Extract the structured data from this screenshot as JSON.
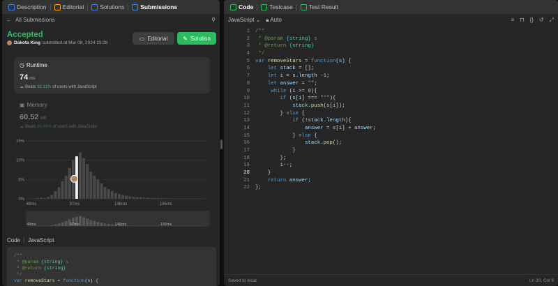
{
  "left_tabs": [
    {
      "label": "Description",
      "icon": "description-icon",
      "color": "#3b82f6"
    },
    {
      "label": "Editorial",
      "icon": "editorial-icon",
      "color": "#ffa116"
    },
    {
      "label": "Solutions",
      "icon": "flask-icon",
      "color": "#3b82f6"
    },
    {
      "label": "Submissions",
      "icon": "history-icon",
      "color": "#3b82f6"
    }
  ],
  "nav": {
    "back_label": "All Submissions"
  },
  "result": {
    "status": "Accepted",
    "author": "Dakota King",
    "submitted_text": "submitted at Mar 08, 2024 15:28",
    "editorial_btn": "Editorial",
    "solution_btn": "Solution"
  },
  "runtime": {
    "title": "Runtime",
    "value": "74",
    "unit": "ms",
    "beats_label": "Beats",
    "beats_pct": "92.11%",
    "beats_suffix": "of users with JavaScript"
  },
  "memory": {
    "title": "Memory",
    "value": "60.52",
    "unit": "MB",
    "beats_label": "Beats",
    "beats_pct": "80.48%",
    "beats_suffix": "of users with JavaScript"
  },
  "chart_data": {
    "type": "bar",
    "yticks": [
      "15%",
      "10%",
      "5%",
      "0%"
    ],
    "xticks": [
      "48ms",
      "97ms",
      "146ms",
      "195ms"
    ],
    "values": [
      0.1,
      0.2,
      0.3,
      0.2,
      0.5,
      1,
      2,
      3,
      4.5,
      6,
      8,
      10,
      11,
      12,
      10.5,
      9,
      7,
      6,
      5,
      4,
      3,
      2.5,
      2,
      1.5,
      1.2,
      1,
      0.8,
      0.6,
      0.5,
      0.4,
      0.4,
      0.3,
      0.3,
      0.2,
      0.2,
      0.2,
      0.15,
      0.1,
      0.1,
      0.1,
      0.1,
      0.1,
      0.05,
      0.05,
      0.05,
      0.05,
      0.05,
      0.05
    ],
    "highlight_index": 12,
    "ylim": [
      0,
      15
    ],
    "color": "#4a4a4a",
    "highlight_color": "#eff1f6"
  },
  "code_section": {
    "label": "Code",
    "language": "JavaScript"
  },
  "right_tabs": [
    {
      "label": "Code",
      "icon": "code-icon",
      "color": "#2cbb5d"
    },
    {
      "label": "Testcase",
      "icon": "checkbox-icon",
      "color": "#2cbb5d"
    },
    {
      "label": "Test Result",
      "icon": "terminal-icon",
      "color": "#2cbb5d"
    }
  ],
  "editor": {
    "language": "JavaScript",
    "mode": "Auto",
    "status_left": "Saved to local",
    "status_right": "Ln 20, Col 9",
    "current_line": 20,
    "lines": [
      [
        [
          "cm",
          "/**"
        ]
      ],
      [
        [
          "cm",
          " * @param "
        ],
        [
          "ty",
          "{string}"
        ],
        [
          "cm",
          " s"
        ]
      ],
      [
        [
          "cm",
          " * @return "
        ],
        [
          "ty",
          "{string}"
        ]
      ],
      [
        [
          "cm",
          " */"
        ]
      ],
      [
        [
          "kw",
          "var "
        ],
        [
          "fn",
          "removeStars"
        ],
        [
          "tx",
          " = "
        ],
        [
          "kw",
          "function"
        ],
        [
          "tx",
          "("
        ],
        [
          "pr",
          "s"
        ],
        [
          "tx",
          ") {"
        ]
      ],
      [
        [
          "tx",
          "    "
        ],
        [
          "kw",
          "let "
        ],
        [
          "pr",
          "stack"
        ],
        [
          "tx",
          " = [];"
        ]
      ],
      [
        [
          "tx",
          "    "
        ],
        [
          "kw",
          "let "
        ],
        [
          "pr",
          "i"
        ],
        [
          "tx",
          " = "
        ],
        [
          "pr",
          "s"
        ],
        [
          "tx",
          "."
        ],
        [
          "pr",
          "length"
        ],
        [
          "tx",
          " -"
        ],
        [
          "num",
          "1"
        ],
        [
          "tx",
          ";"
        ]
      ],
      [
        [
          "tx",
          "    "
        ],
        [
          "kw",
          "let "
        ],
        [
          "pr",
          "answer"
        ],
        [
          "tx",
          " = "
        ],
        [
          "str",
          "\"\""
        ],
        [
          "tx",
          ";"
        ]
      ],
      [
        [
          "tx",
          "     "
        ],
        [
          "kw",
          "while"
        ],
        [
          "tx",
          " ("
        ],
        [
          "pr",
          "i"
        ],
        [
          "tx",
          " >= "
        ],
        [
          "num",
          "0"
        ],
        [
          "tx",
          "){"
        ]
      ],
      [
        [
          "tx",
          "        "
        ],
        [
          "kw",
          "if"
        ],
        [
          "tx",
          " ("
        ],
        [
          "pr",
          "s"
        ],
        [
          "tx",
          "["
        ],
        [
          "pr",
          "i"
        ],
        [
          "tx",
          "] === "
        ],
        [
          "str",
          "\"*\""
        ],
        [
          "tx",
          "){"
        ]
      ],
      [
        [
          "tx",
          "            "
        ],
        [
          "pr",
          "stack"
        ],
        [
          "tx",
          "."
        ],
        [
          "fn",
          "push"
        ],
        [
          "tx",
          "("
        ],
        [
          "pr",
          "s"
        ],
        [
          "tx",
          "["
        ],
        [
          "pr",
          "i"
        ],
        [
          "tx",
          "]);"
        ]
      ],
      [
        [
          "tx",
          "        } "
        ],
        [
          "kw",
          "else"
        ],
        [
          "tx",
          " {"
        ]
      ],
      [
        [
          "tx",
          "            "
        ],
        [
          "kw",
          "if"
        ],
        [
          "tx",
          " (!"
        ],
        [
          "pr",
          "stack"
        ],
        [
          "tx",
          "."
        ],
        [
          "pr",
          "length"
        ],
        [
          "tx",
          "){"
        ]
      ],
      [
        [
          "tx",
          "                "
        ],
        [
          "pr",
          "answer"
        ],
        [
          "tx",
          " = "
        ],
        [
          "pr",
          "s"
        ],
        [
          "tx",
          "["
        ],
        [
          "pr",
          "i"
        ],
        [
          "tx",
          "] + "
        ],
        [
          "pr",
          "answer"
        ],
        [
          "tx",
          ";"
        ]
      ],
      [
        [
          "tx",
          "            } "
        ],
        [
          "kw",
          "else"
        ],
        [
          "tx",
          " {"
        ]
      ],
      [
        [
          "tx",
          "                "
        ],
        [
          "pr",
          "stack"
        ],
        [
          "tx",
          "."
        ],
        [
          "fn",
          "pop"
        ],
        [
          "tx",
          "();"
        ]
      ],
      [
        [
          "tx",
          "            }"
        ]
      ],
      [
        [
          "tx",
          "        };"
        ]
      ],
      [
        [
          "tx",
          "        "
        ],
        [
          "pr",
          "i"
        ],
        [
          "tx",
          "--;"
        ]
      ],
      [
        [
          "tx",
          "    }"
        ]
      ],
      [
        [
          "tx",
          "    "
        ],
        [
          "kw",
          "return "
        ],
        [
          "pr",
          "answer"
        ],
        [
          "tx",
          ";"
        ]
      ],
      [
        [
          "tx",
          "};"
        ]
      ]
    ]
  },
  "preview_lines": [
    [
      [
        "cm",
        "/**"
      ]
    ],
    [
      [
        "cm",
        " * @param "
      ],
      [
        "ty",
        "{string}"
      ],
      [
        "cm",
        " s"
      ]
    ],
    [
      [
        "cm",
        " * @return "
      ],
      [
        "ty",
        "{string}"
      ]
    ],
    [
      [
        "cm",
        " */"
      ]
    ],
    [
      [
        "kw",
        "var "
      ],
      [
        "fn",
        "removeStars"
      ],
      [
        "tx",
        " = "
      ],
      [
        "kw",
        "function"
      ],
      [
        "tx",
        "("
      ],
      [
        "pr",
        "s"
      ],
      [
        "tx",
        ") {"
      ]
    ]
  ]
}
